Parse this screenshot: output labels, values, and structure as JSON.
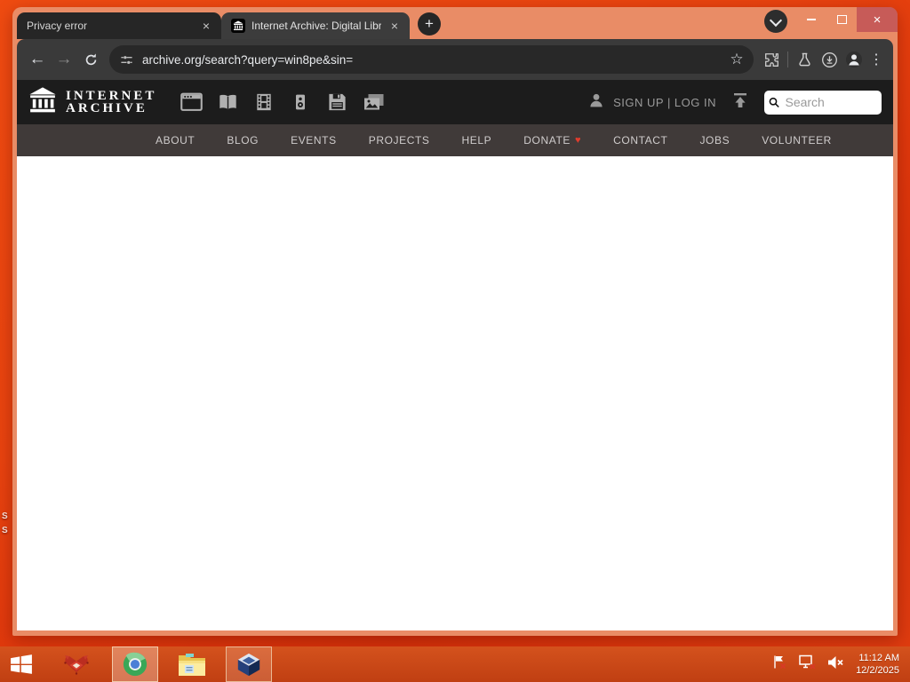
{
  "browser": {
    "tabs": [
      {
        "title": "Privacy error",
        "active": false
      },
      {
        "title": "Internet Archive: Digital Library",
        "active": true
      }
    ],
    "tab_close_glyph": "×",
    "new_tab_glyph": "+",
    "window_close_glyph": "×",
    "back_glyph": "←",
    "forward_glyph": "→",
    "star_glyph": "☆",
    "kebab_glyph": "⋮",
    "url": "archive.org/search?query=win8pe&sin="
  },
  "ia": {
    "logo_line1": "INTERNET",
    "logo_line2": "ARCHIVE",
    "media_types": [
      "web",
      "texts",
      "video",
      "audio",
      "software",
      "images"
    ],
    "account_text": "SIGN UP | LOG IN",
    "search_placeholder": "Search",
    "nav": [
      "ABOUT",
      "BLOG",
      "EVENTS",
      "PROJECTS",
      "HELP",
      "DONATE",
      "CONTACT",
      "JOBS",
      "VOLUNTEER"
    ],
    "donate_heart": "♥"
  },
  "desktop": {
    "partial_label_1": "S",
    "partial_label_2": "S"
  },
  "taskbar": {
    "apps": [
      "start",
      "red-app",
      "chromium",
      "file-explorer",
      "virtualbox"
    ],
    "tray_icons": [
      "action-center-flag",
      "network-disconnected",
      "volume-muted"
    ],
    "time": "11:12 AM",
    "date": "12/2/2025"
  },
  "colors": {
    "desktop": "#e8430f",
    "frame": "#e98c66",
    "toolbar": "#3a3a3a",
    "url_pill": "#282828",
    "ia_header": "#1c1c1c",
    "ia_nav": "#403a39",
    "close_button": "#c75b58",
    "taskbar": "#c8461a",
    "heart": "#e03c2d"
  }
}
